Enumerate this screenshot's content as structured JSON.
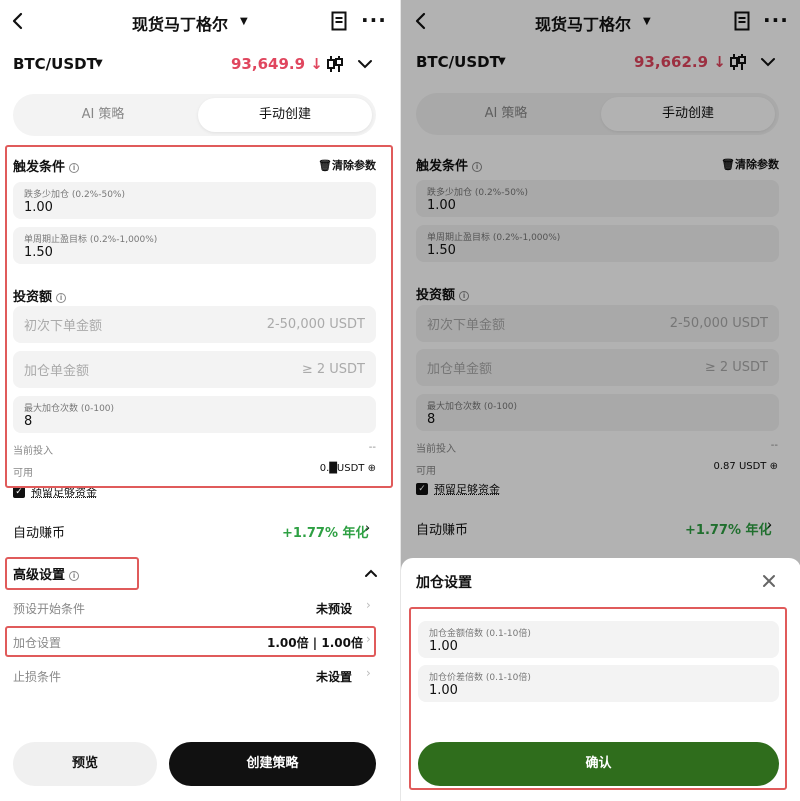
{
  "header": {
    "title": "现货马丁格尔",
    "pair": "BTC/USDT"
  },
  "left": {
    "price": "93,649.9 ↓",
    "tabs": {
      "ai": "AI 策略",
      "manual": "手动创建"
    },
    "trigger": {
      "title": "触发条件",
      "clear": "清除参数",
      "drop_label": "跌多少加仓 (0.2%-50%)",
      "drop_value": "1.00",
      "tp_label": "单周期止盈目标 (0.2%-1,000%)",
      "tp_value": "1.50"
    },
    "invest": {
      "title": "投资额",
      "initial_placeholder": "初次下单金额",
      "initial_range": "2-50,000 USDT",
      "add_placeholder": "加仓单金额",
      "add_range": "≥ 2 USDT",
      "max_label": "最大加仓次数 (0-100)",
      "max_value": "8",
      "current_label": "当前投入",
      "current_value": "--",
      "available_label": "可用",
      "available_value": "0.█USDT",
      "reserve_label": "预留足够资金"
    },
    "auto_earn": {
      "label": "自动赚币",
      "value": "+1.77% 年化"
    },
    "advanced": {
      "title": "高级设置",
      "preset_label": "预设开始条件",
      "preset_value": "未预设",
      "addpos_label": "加仓设置",
      "addpos_value": "1.00倍 | 1.00倍",
      "stoploss_label": "止损条件",
      "stoploss_value": "未设置"
    },
    "buttons": {
      "preview": "预览",
      "create": "创建策略"
    }
  },
  "right": {
    "price": "93,662.9 ↓",
    "tabs": {
      "ai": "AI 策略",
      "manual": "手动创建"
    },
    "trigger": {
      "title": "触发条件",
      "clear": "清除参数",
      "drop_label": "跌多少加仓 (0.2%-50%)",
      "drop_value": "1.00",
      "tp_label": "单周期止盈目标 (0.2%-1,000%)",
      "tp_value": "1.50"
    },
    "invest": {
      "title": "投资额",
      "initial_placeholder": "初次下单金额",
      "initial_range": "2-50,000 USDT",
      "add_placeholder": "加仓单金额",
      "add_range": "≥ 2 USDT",
      "max_label": "最大加仓次数 (0-100)",
      "max_value": "8",
      "current_label": "当前投入",
      "current_value": "--",
      "available_label": "可用",
      "available_value": "0.87 USDT",
      "reserve_label": "预留足够资金"
    },
    "auto_earn": {
      "label": "自动赚币",
      "value": "+1.77% 年化"
    },
    "sheet": {
      "title": "加仓设置",
      "amount_label": "加仓金额倍数 (0.1-10倍)",
      "amount_value": "1.00",
      "spread_label": "加仓价差倍数 (0.1-10倍)",
      "spread_value": "1.00",
      "confirm": "确认"
    }
  },
  "colors": {
    "price_red": "#e0465e",
    "green": "#2ea043",
    "confirm_green": "#2f6d1c",
    "highlight": "#e05b5b"
  },
  "icons": [
    "back-icon",
    "caret-down-icon",
    "document-icon",
    "more-icon",
    "candlestick-icon",
    "chevron-down-icon",
    "info-icon",
    "trash-icon",
    "plus-circle-icon",
    "checkbox-icon",
    "chevron-right-icon",
    "chevron-up-icon",
    "close-icon"
  ]
}
